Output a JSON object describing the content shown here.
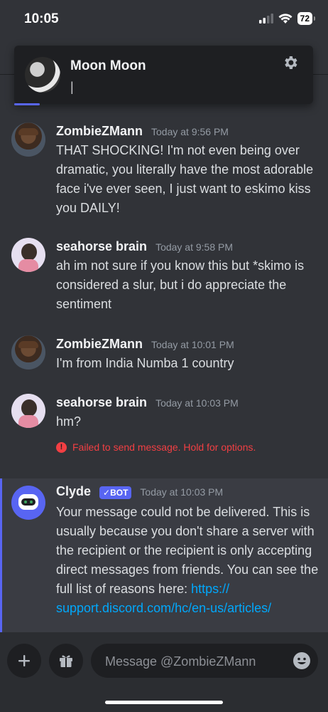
{
  "status_bar": {
    "time": "10:05",
    "battery": "72"
  },
  "profile_popup": {
    "name": "Moon Moon",
    "cursor_text": "|"
  },
  "messages": [
    {
      "author": "ZombieZMann",
      "timestamp": "Today at 9:56 PM",
      "text": "THAT SHOCKING! I'm not even being over dramatic, you literally have the most adorable face i've ever seen, I just want to eskimo kiss you DAILY!"
    },
    {
      "author": "seahorse brain",
      "timestamp": "Today at 9:58 PM",
      "text": "ah im not sure if you know this but *skimo is considered a slur, but i do appreciate the sentiment"
    },
    {
      "author": "ZombieZMann",
      "timestamp": "Today at 10:01 PM",
      "text": "I'm from India Numba 1 country"
    },
    {
      "author": "seahorse brain",
      "timestamp": "Today at 10:03 PM",
      "text": "hm?"
    }
  ],
  "failed_notice": "Failed to send message. Hold for options.",
  "clyde": {
    "author": "Clyde",
    "badge": "✓BOT",
    "timestamp": "Today at 10:03 PM",
    "text": "Your message could not be delivered. This is usually because you don't share a server with the recipient or the recipient is only accepting direct messages from friends. You can see the full list of reasons here: ",
    "link": "https://\nsupport.discord.com/hc/en-us/articles/"
  },
  "composer": {
    "placeholder": "Message @ZombieZMann"
  },
  "colors": {
    "accent": "#5865f2",
    "error": "#f23f43",
    "link": "#00a8fc"
  }
}
